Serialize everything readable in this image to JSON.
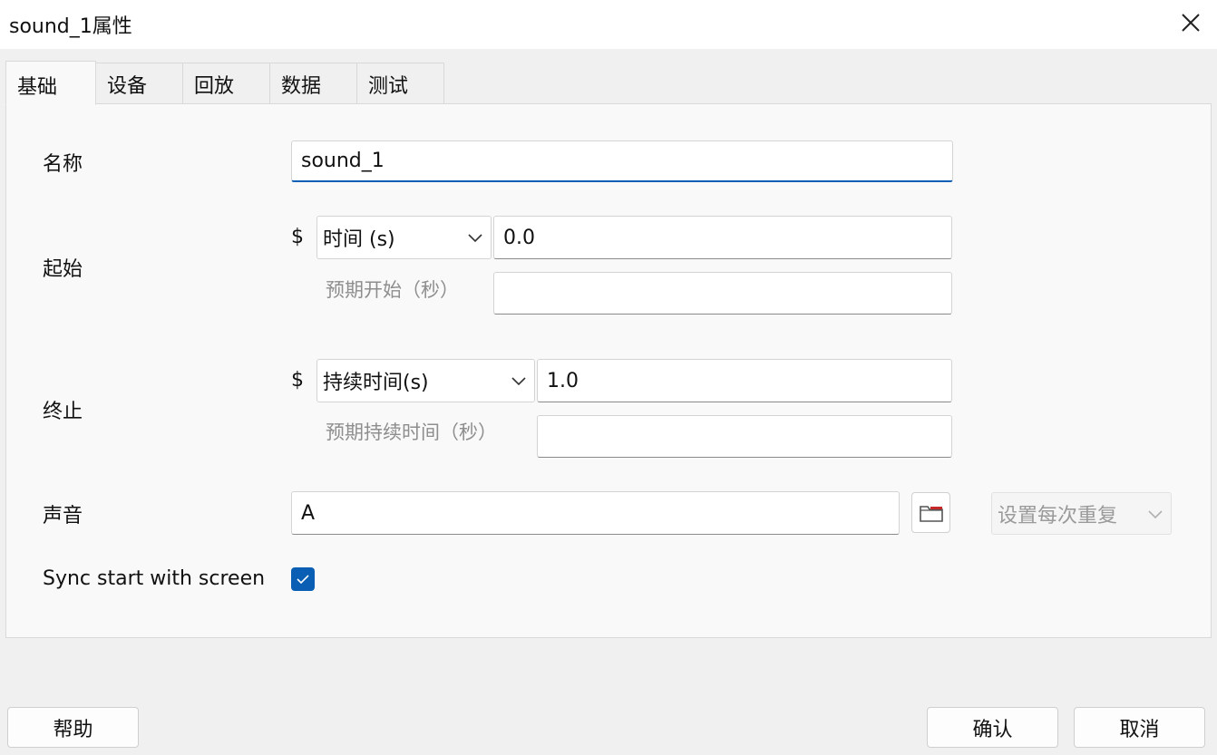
{
  "window": {
    "title": "sound_1属性"
  },
  "tabs": [
    {
      "label": "基础"
    },
    {
      "label": "设备"
    },
    {
      "label": "回放"
    },
    {
      "label": "数据"
    },
    {
      "label": "测试"
    }
  ],
  "basic": {
    "name_label": "名称",
    "name_value": "sound_1",
    "start_label": "起始",
    "start_dollar": "$",
    "start_type": "时间 (s)",
    "start_value": "0.0",
    "start_expected_label": "预期开始（秒）",
    "start_expected_value": "",
    "stop_label": "终止",
    "stop_dollar": "$",
    "stop_type": "持续时间(s)",
    "stop_value": "1.0",
    "stop_expected_label": "预期持续时间（秒）",
    "stop_expected_value": "",
    "sound_label": "声音",
    "sound_value": "A",
    "repeat_select": "设置每次重复",
    "sync_label": "Sync start with screen",
    "sync_checked": true
  },
  "buttons": {
    "help": "帮助",
    "ok": "确认",
    "cancel": "取消"
  },
  "colors": {
    "accent": "#0a5fb4",
    "folder_icon": "#c62828"
  },
  "icons": {
    "close": "close-icon",
    "chevron": "chevron-down-icon",
    "folder": "folder-icon",
    "check": "check-icon"
  }
}
